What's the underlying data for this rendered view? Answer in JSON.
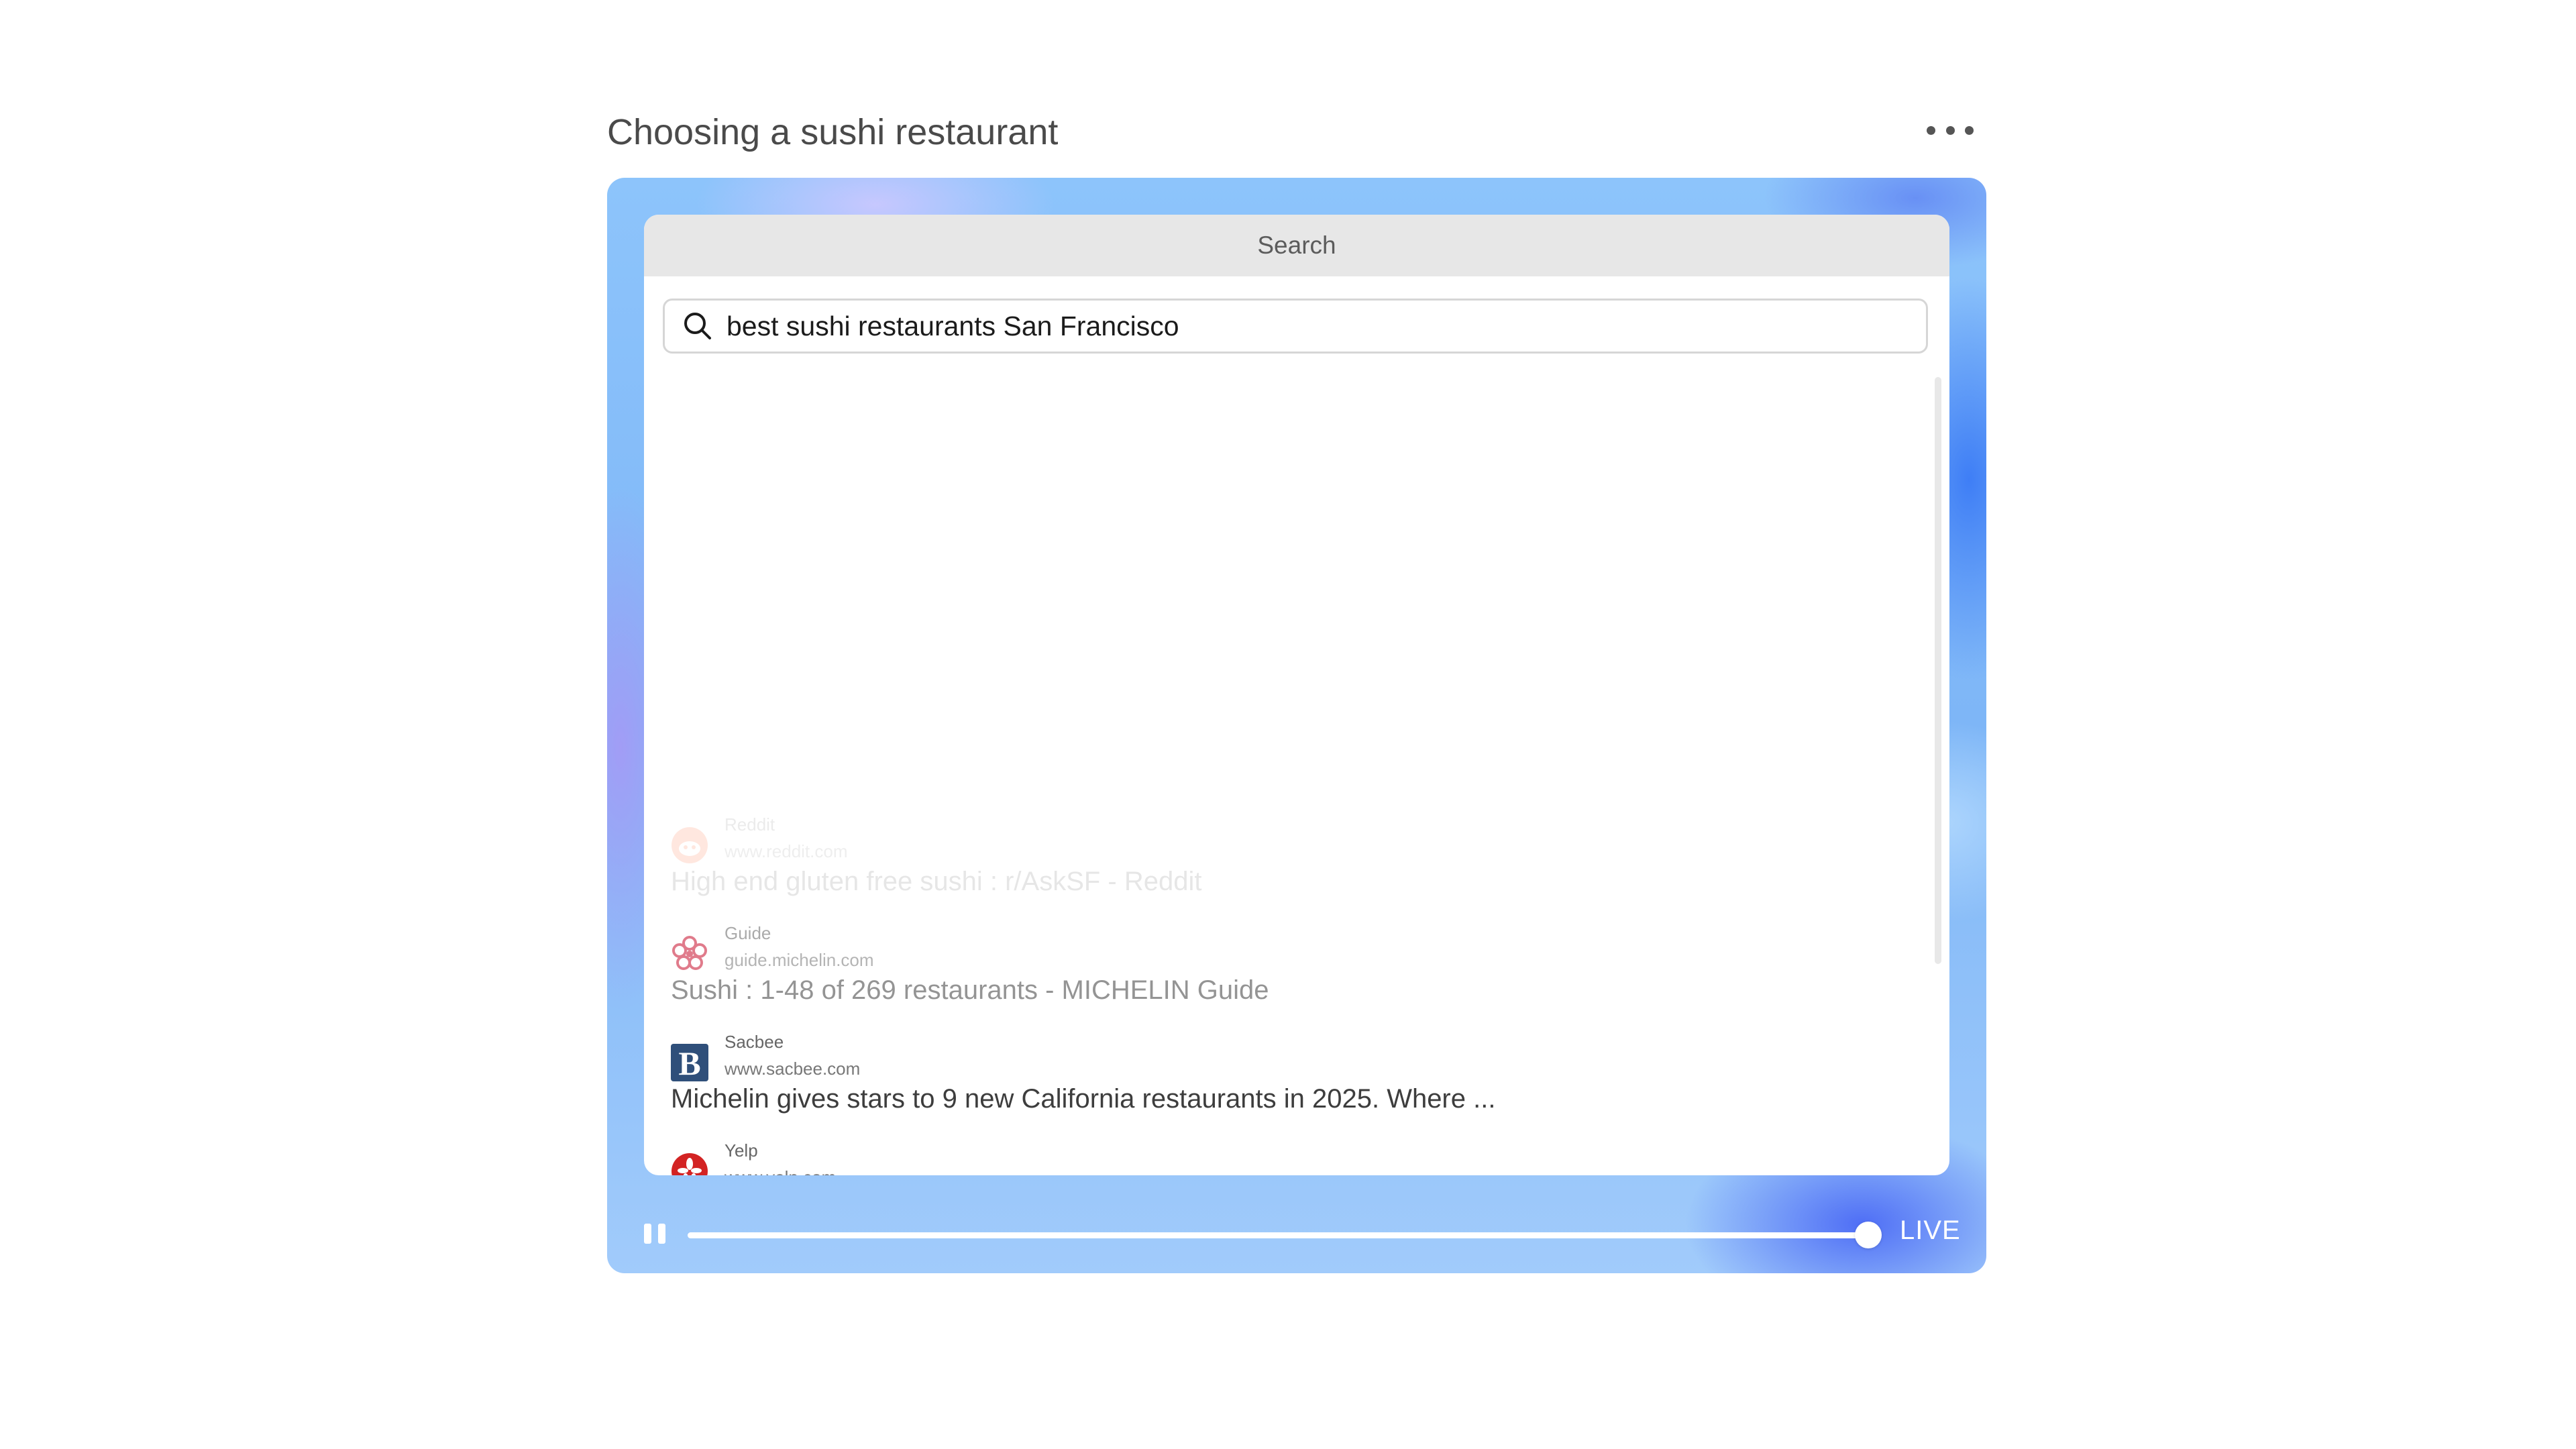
{
  "header": {
    "title": "Choosing a sushi restaurant",
    "more_icon": "more-horizontal-icon"
  },
  "window": {
    "title": "Search"
  },
  "search": {
    "icon": "search-icon",
    "query": "best sushi restaurants San Francisco"
  },
  "results": [
    {
      "source": "Reddit",
      "domain": "www.reddit.com",
      "title": "High end gluten free sushi : r/AskSF - Reddit",
      "icon": "reddit-icon",
      "color": "#ff4500"
    },
    {
      "source": "Guide",
      "domain": "guide.michelin.com",
      "title": "Sushi : 1-48 of 269 restaurants - MICHELIN Guide",
      "icon": "michelin-flower-icon",
      "color": "#c8102e"
    },
    {
      "source": "Sacbee",
      "domain": "www.sacbee.com",
      "title": "Michelin gives stars to 9 new California restaurants in 2025. Where ...",
      "icon": "sacbee-b-icon",
      "color": "#2f4f7a"
    },
    {
      "source": "Yelp",
      "domain": "www.yelp.com",
      "title": "",
      "icon": "yelp-icon",
      "color": "#d32323"
    }
  ],
  "playback": {
    "pause_icon": "pause-icon",
    "progress": 1.0,
    "live_label": "LIVE"
  }
}
